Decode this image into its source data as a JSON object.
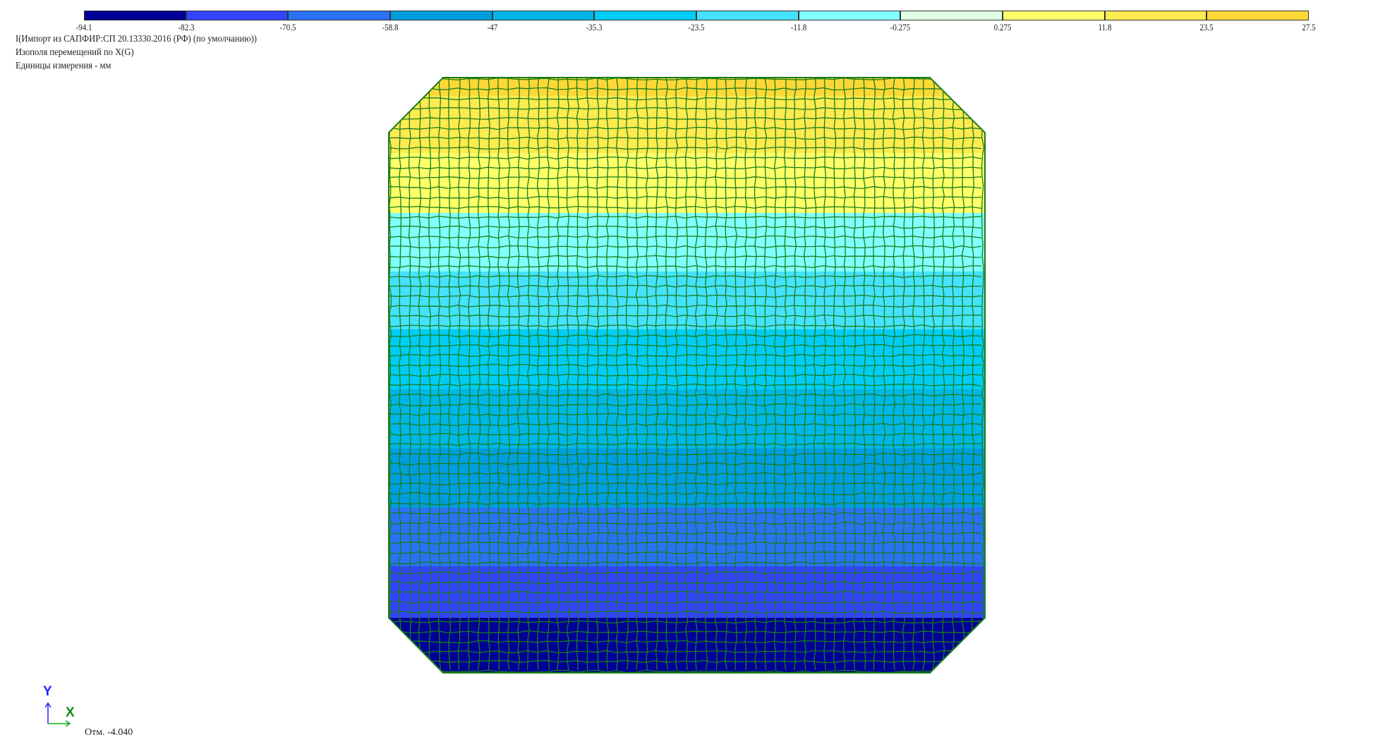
{
  "legend": {
    "colors": [
      "#000096",
      "#3344ff",
      "#2a72f4",
      "#009ddf",
      "#00b6e6",
      "#00cdf6",
      "#44e2ff",
      "#80ffff",
      "#e0ffe2",
      "#ffff6a",
      "#ffea50",
      "#ffd837"
    ],
    "ticks": [
      "-94.1",
      "-82.3",
      "-70.5",
      "-58.8",
      "-47",
      "-35.3",
      "-23.5",
      "-11.8",
      "-0.275",
      "0.275",
      "11.8",
      "23.5",
      "27.5"
    ]
  },
  "info": {
    "load_case": "I(Импорт из САПФИР:СП 20.13330.2016 (РФ) (по умолчанию))",
    "field": "Изополя перемещений по X(G)",
    "units": "Единицы измерения - мм"
  },
  "mesh": {
    "band_colors_top_to_bottom": [
      "#ffd837",
      "#ffea50",
      "#ffff6a",
      "#80ffff",
      "#44e2ff",
      "#00cdf6",
      "#00b6e6",
      "#009ddf",
      "#2a72f4",
      "#3344ff",
      "#000096"
    ],
    "line_color": "#1a7d1a"
  },
  "axes": {
    "y_label": "Y",
    "x_label": "X"
  },
  "elevation": "Отм. -4.040"
}
